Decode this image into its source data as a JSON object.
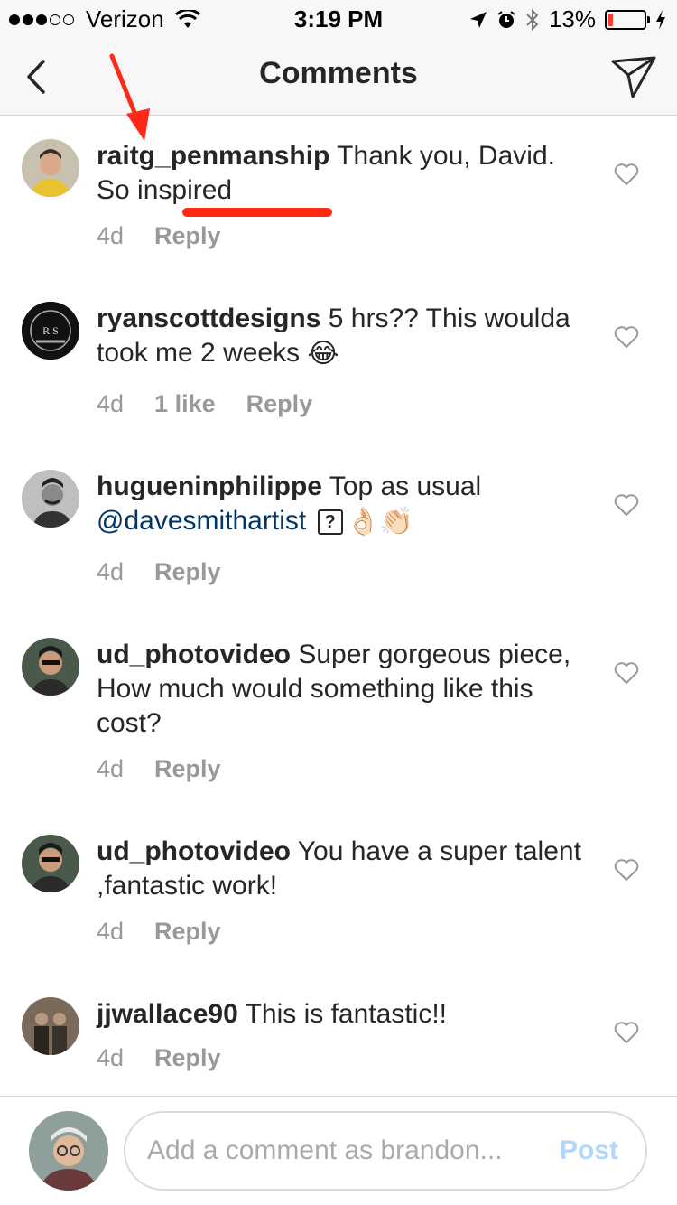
{
  "status_bar": {
    "carrier": "Verizon",
    "time": "3:19 PM",
    "battery": "13%",
    "battery_level": 0.13
  },
  "nav": {
    "title": "Comments"
  },
  "comments": [
    {
      "username": "raitg_penmanship",
      "text_before": " Thank you, David. ",
      "text_highlight": "So inspired",
      "time": "4d",
      "reply": "Reply"
    },
    {
      "username": "ryanscottdesigns",
      "text": " 5 hrs?? This woulda took me 2 weeks",
      "emoji": "😂",
      "time": "4d",
      "likes": "1 like",
      "reply": "Reply"
    },
    {
      "username": "hugueninphilippe",
      "text": " Top as usual ",
      "mention": "@davesmithartist",
      "unknown_glyph": "?",
      "emoji": "👌🏻👏🏻",
      "time": "4d",
      "reply": "Reply"
    },
    {
      "username": "ud_photovideo",
      "text": " Super gorgeous piece,  How much would something like this cost?",
      "time": "4d",
      "reply": "Reply"
    },
    {
      "username": "ud_photovideo",
      "text": " You have a super talent ,fantastic work!",
      "time": "4d",
      "reply": "Reply"
    },
    {
      "username": "jjwallace90",
      "text": " This is fantastic!!",
      "time": "4d",
      "reply": "Reply"
    }
  ],
  "composer": {
    "placeholder": "Add a comment as brandon...",
    "post_label": "Post"
  },
  "colors": {
    "accent_link": "#003569",
    "annotation": "#ff2a16",
    "post_disabled": "#b3d7fb",
    "meta_gray": "#999999"
  },
  "icons": {
    "back": "chevron-left-icon",
    "send": "paper-plane-icon",
    "like": "heart-outline-icon",
    "location": "location-arrow-icon",
    "alarm": "alarm-icon",
    "bluetooth": "bluetooth-icon",
    "charging": "charging-bolt-icon"
  }
}
